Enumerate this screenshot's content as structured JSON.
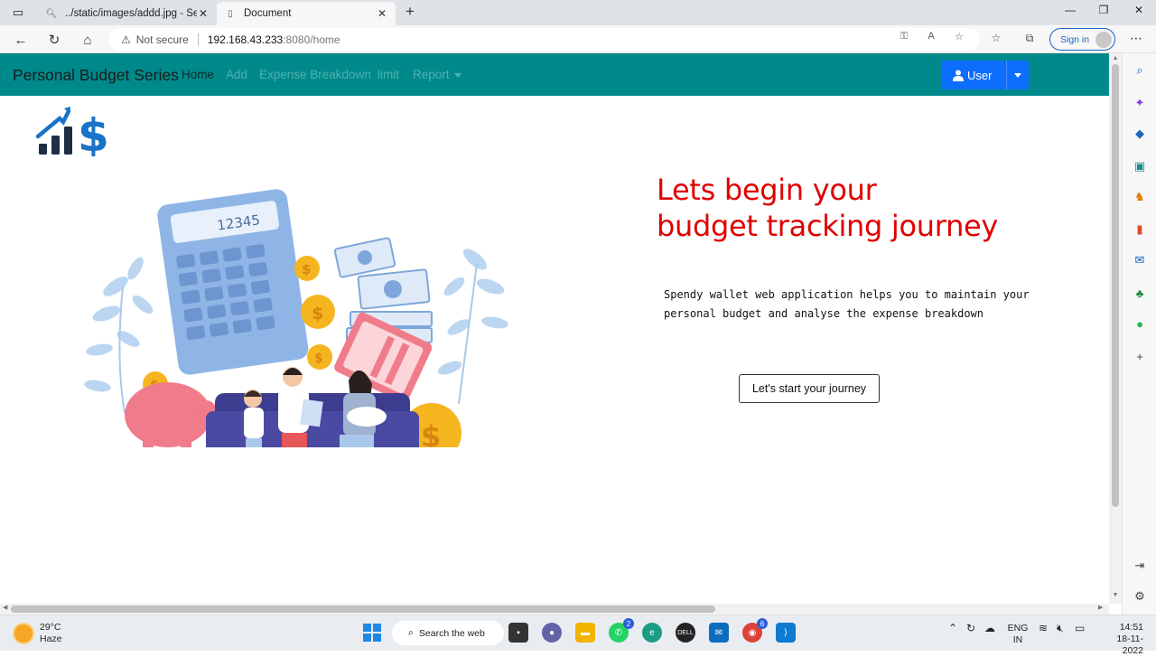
{
  "browser": {
    "tabs": [
      {
        "title": "../static/images/addd.jpg - Searc"
      },
      {
        "title": "Document"
      }
    ],
    "security_label": "Not secure",
    "url_host": "192.168.43.233",
    "url_path": ":8080/home",
    "signin_label": "Sign in"
  },
  "app": {
    "brand": "Personal Budget Series",
    "nav": [
      {
        "label": "Home"
      },
      {
        "label": "Add"
      },
      {
        "label": "Expense Breakdown"
      },
      {
        "label": "limit"
      },
      {
        "label": "Report"
      }
    ],
    "user_button": "User",
    "calculator_display": "12345"
  },
  "hero": {
    "headline_line1": "Lets begin your",
    "headline_line2": "budget tracking journey",
    "description_line1": "Spendy wallet web application helps you to maintain your",
    "description_line2": "personal budget and analyse the expense breakdown",
    "cta_label": "Let's start your journey"
  },
  "taskbar": {
    "temperature": "29°C",
    "weather": "Haze",
    "search_label": "Search the web",
    "whatsapp_badge": "2",
    "chrome_badge": "6",
    "lang_top": "ENG",
    "lang_bottom": "IN",
    "time": "14:51",
    "date": "18-11-2022"
  },
  "colors": {
    "navbar": "#00898a",
    "headline": "#e00000",
    "user_button": "#0d6efd"
  }
}
